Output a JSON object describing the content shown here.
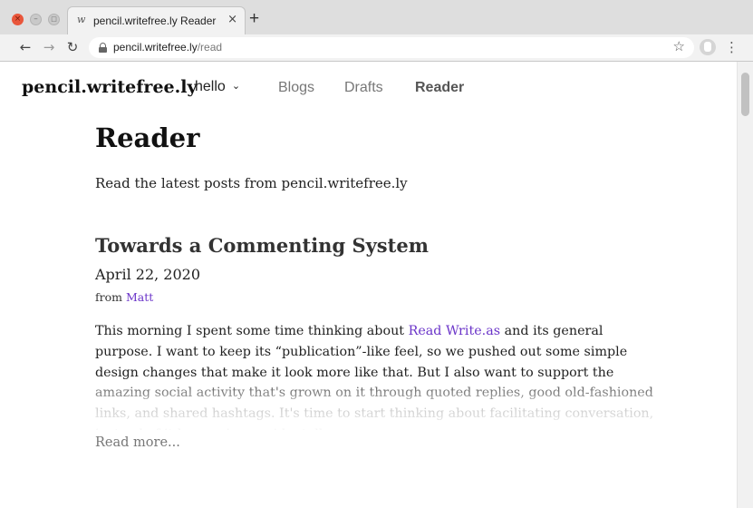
{
  "browser": {
    "tab": {
      "favicon": "w",
      "title": "pencil.writefree.ly Reader",
      "close": "×"
    },
    "new_tab": "+",
    "url": {
      "host": "pencil.writefree.ly",
      "path": "/read"
    },
    "icons": {
      "back": "arrow-left-icon",
      "forward": "arrow-right-icon",
      "reload": "reload-icon",
      "lock": "lock-icon",
      "bookmark": "star-icon",
      "profile": "profile-icon",
      "menu": "more-vertical-icon"
    }
  },
  "header": {
    "site_title": "pencil.writefree.ly",
    "user_menu": "hello",
    "nav": {
      "blogs": "Blogs",
      "drafts": "Drafts",
      "reader": "Reader"
    }
  },
  "page": {
    "title": "Reader",
    "description": "Read the latest posts from pencil.writefree.ly"
  },
  "post": {
    "title": "Towards a Commenting System",
    "date": "April 22, 2020",
    "author_prefix": "from",
    "author": "Matt",
    "body_before_link": "This morning I spent some time thinking about ",
    "body_link": "Read Write.as",
    "body_after_link": " and its general purpose. I want to keep its “publication”-like feel, so we pushed out some simple design changes that make it look more like that. But I also want to support the amazing social activity that's grown on it through quoted replies, good old-fashioned links, and shared hashtags. It's time to start thinking about facilitating conversation, instead of it happening accidentally.",
    "read_more": "Read more..."
  },
  "colors": {
    "link": "#6b35c9",
    "tab_bar": "#dedede",
    "close_button": "#e9563b"
  }
}
